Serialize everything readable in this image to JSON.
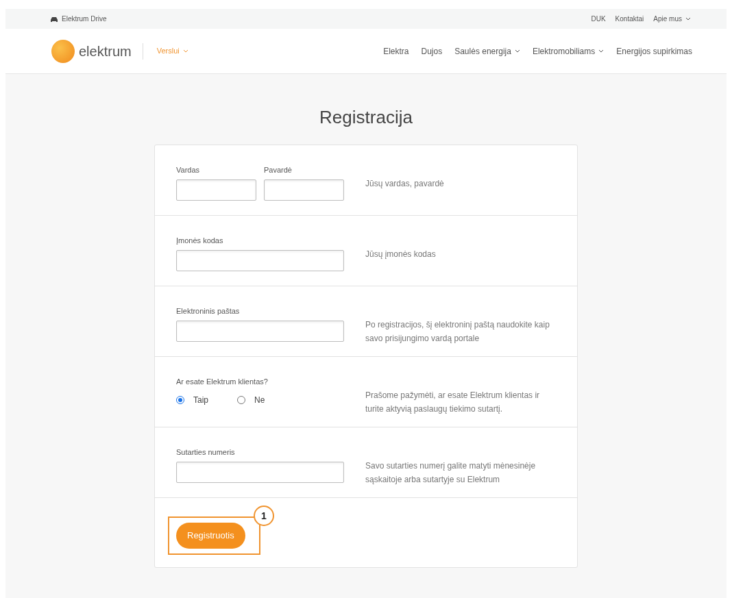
{
  "top_bar": {
    "brand": "Elektrum Drive",
    "links": [
      {
        "label": "DUK",
        "dropdown": false
      },
      {
        "label": "Kontaktai",
        "dropdown": false
      },
      {
        "label": "Apie mus",
        "dropdown": true
      }
    ]
  },
  "header": {
    "logo_text": "elektrum",
    "segment": "Verslui",
    "nav": [
      {
        "label": "Elektra",
        "dropdown": false
      },
      {
        "label": "Dujos",
        "dropdown": false
      },
      {
        "label": "Saulės energija",
        "dropdown": true
      },
      {
        "label": "Elektromobiliams",
        "dropdown": true
      },
      {
        "label": "Energijos supirkimas",
        "dropdown": false
      }
    ]
  },
  "title": "Registracija",
  "sections": [
    {
      "kind": "names",
      "fields": [
        {
          "label": "Vardas"
        },
        {
          "label": "Pavardė"
        }
      ],
      "help": "Jūsų vardas, pavardė"
    },
    {
      "kind": "field",
      "label": "Įmonės kodas",
      "help": "Jūsų įmonės kodas"
    },
    {
      "kind": "field",
      "label": "Elektroninis paštas",
      "help": "Po registracijos, šį elektroninį paštą naudokite kaip savo prisijungimo vardą portale"
    },
    {
      "kind": "radio",
      "label": "Ar esate Elektrum klientas?",
      "options": [
        {
          "label": "Taip",
          "selected": true
        },
        {
          "label": "Ne",
          "selected": false
        }
      ],
      "help": "Prašome pažymėti, ar esate Elektrum klientas ir turite aktyvią paslaugų tiekimo sutartį."
    },
    {
      "kind": "field",
      "label": "Sutarties numeris",
      "help": "Savo sutarties numerį galite matyti mėnesinėje sąskaitoje arba sutartyje su Elektrum"
    }
  ],
  "submit": {
    "label": "Registruotis",
    "callout": "1"
  }
}
